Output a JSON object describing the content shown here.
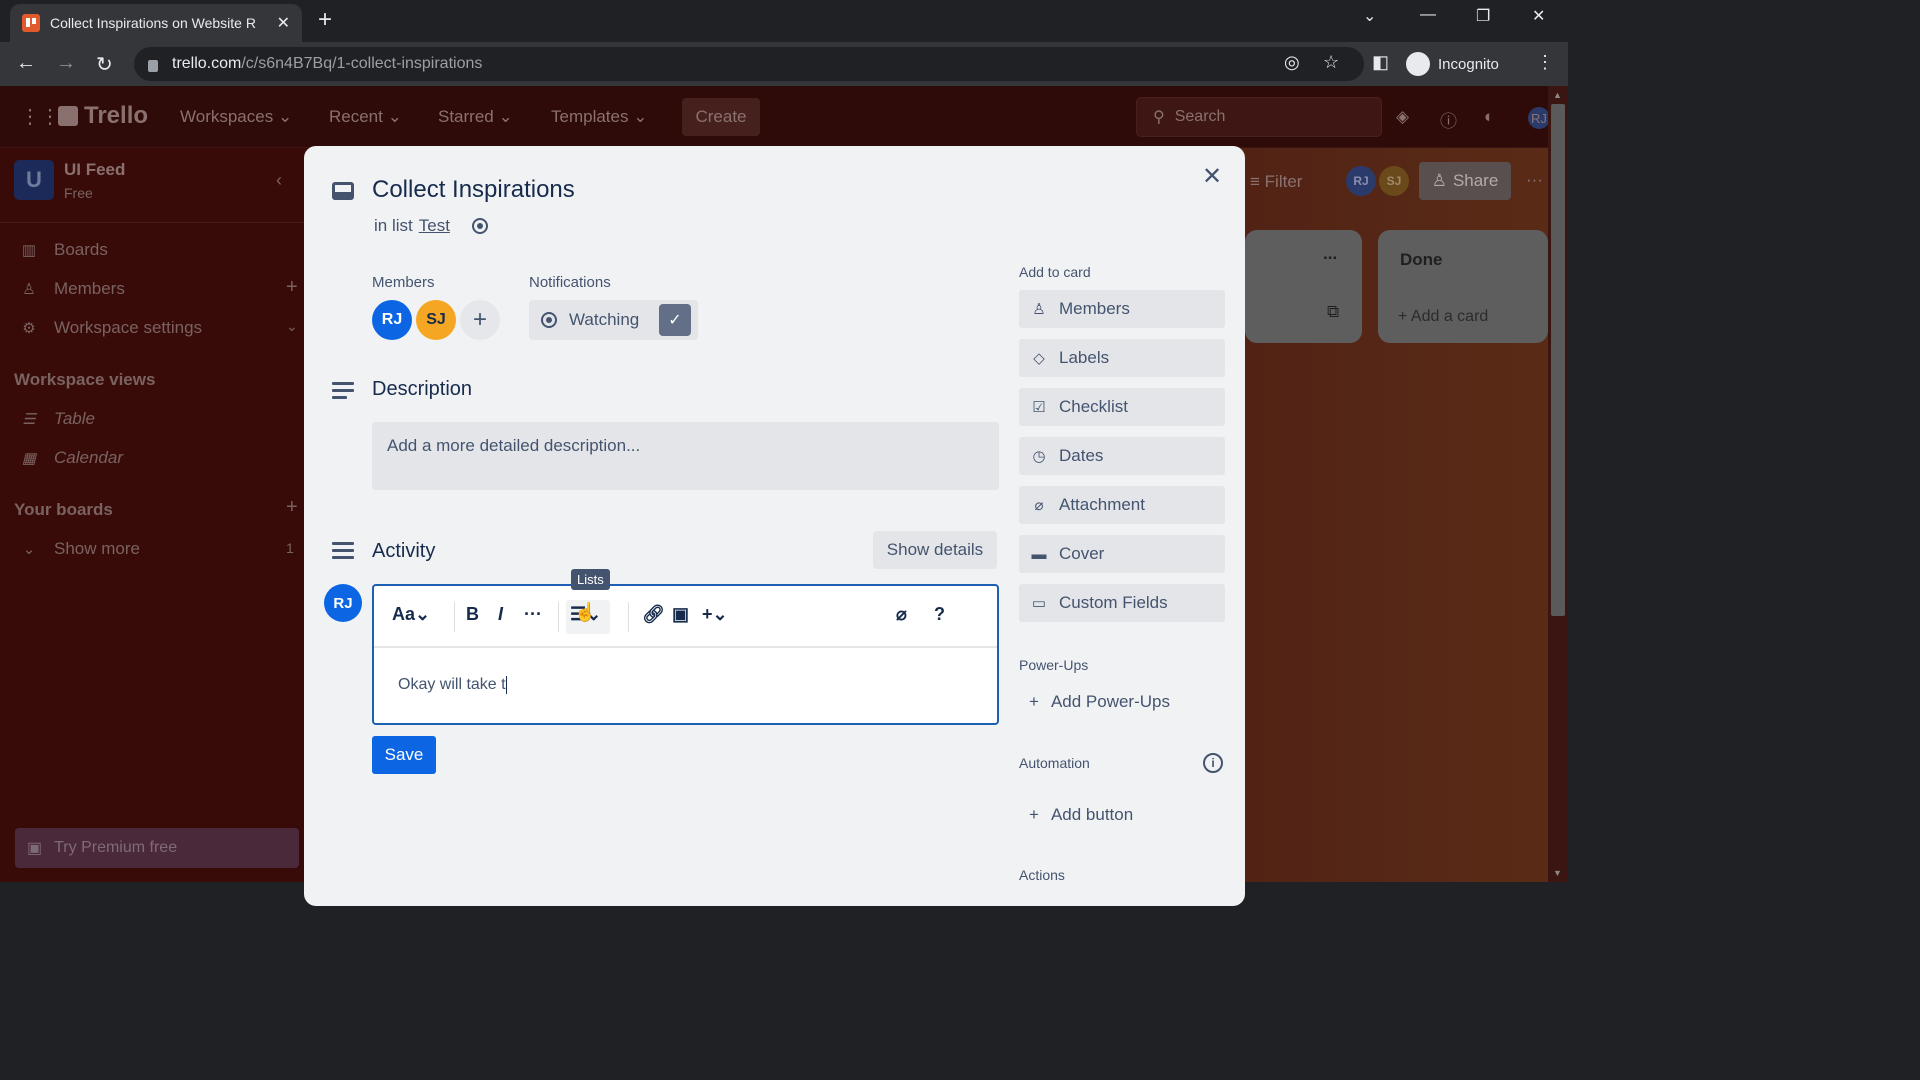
{
  "browser": {
    "tab_title": "Collect Inspirations on Website R",
    "url_host": "trello.com",
    "url_path": "/c/s6n4B7Bq/1-collect-inspirations",
    "profile_label": "Incognito"
  },
  "header": {
    "logo": "Trello",
    "nav": [
      "Workspaces",
      "Recent",
      "Starred",
      "Templates"
    ],
    "create_label": "Create",
    "search_placeholder": "Search",
    "user_initials": "RJ"
  },
  "sidebar": {
    "workspace_initial": "U",
    "workspace_name": "UI Feed",
    "workspace_plan": "Free",
    "items": [
      {
        "label": "Boards",
        "icon": "board-icon"
      },
      {
        "label": "Members",
        "icon": "person-icon"
      },
      {
        "label": "Workspace settings",
        "icon": "gear-icon"
      }
    ],
    "views_heading": "Workspace views",
    "views": [
      {
        "label": "Table",
        "icon": "table-icon"
      },
      {
        "label": "Calendar",
        "icon": "calendar-icon"
      }
    ],
    "boards_heading": "Your boards",
    "show_more": "Show more",
    "show_more_count": "1",
    "premium_label": "Try Premium free"
  },
  "board": {
    "filter_label": "Filter",
    "members": [
      "RJ",
      "SJ"
    ],
    "share_label": "Share",
    "lists": [
      {
        "title": "",
        "menu": "..."
      },
      {
        "title": "Done",
        "add_card": "Add a card"
      }
    ]
  },
  "card": {
    "title": "Collect Inspirations",
    "in_list_prefix": "in list",
    "list_name": "Test",
    "members_label": "Members",
    "members": [
      {
        "initials": "RJ",
        "color": "#0c66e4"
      },
      {
        "initials": "SJ",
        "color": "#f5a623"
      }
    ],
    "notifications_label": "Notifications",
    "watching_label": "Watching",
    "description_title": "Description",
    "description_placeholder": "Add a more detailed description...",
    "activity_title": "Activity",
    "show_details_label": "Show details",
    "comment_avatar": "RJ",
    "editor": {
      "text_style": "Aa",
      "bold": "B",
      "italic": "I",
      "more": "···",
      "lists_tooltip": "Lists",
      "help": "?",
      "content": "Okay will take t"
    },
    "save_label": "Save"
  },
  "add_to_card": {
    "heading": "Add to card",
    "buttons": [
      {
        "label": "Members",
        "icon": "person-icon"
      },
      {
        "label": "Labels",
        "icon": "tag-icon"
      },
      {
        "label": "Checklist",
        "icon": "checklist-icon"
      },
      {
        "label": "Dates",
        "icon": "clock-icon"
      },
      {
        "label": "Attachment",
        "icon": "paperclip-icon"
      },
      {
        "label": "Cover",
        "icon": "cover-icon"
      },
      {
        "label": "Custom Fields",
        "icon": "custom-fields-icon"
      }
    ],
    "powerups_heading": "Power-Ups",
    "add_powerups": "Add Power-Ups",
    "automation_heading": "Automation",
    "add_button": "Add button",
    "actions_heading": "Actions"
  }
}
